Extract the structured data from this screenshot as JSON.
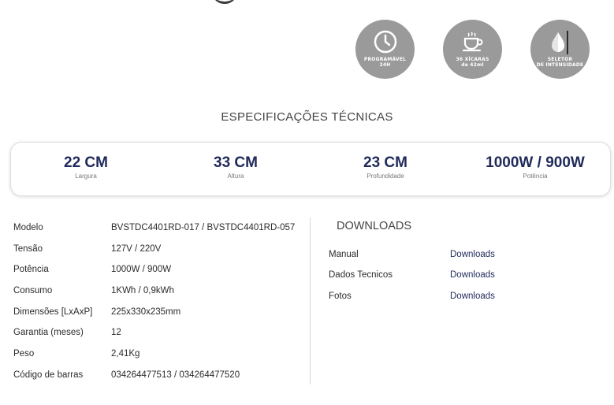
{
  "features": [
    {
      "icon": "clock-icon",
      "line1": "PROGRAMÁVEL",
      "line2": "24H"
    },
    {
      "icon": "coffee-cup-icon",
      "line1": "36 XÍCARAS",
      "line2": "de 42ml"
    },
    {
      "icon": "intensity-drop-icon",
      "line1": "SELETOR",
      "line2": "DE INTENSIDADE"
    }
  ],
  "specs_title": "ESPECIFICAÇÕES TÉCNICAS",
  "dimensions": [
    {
      "value": "22 CM",
      "label": "Largura"
    },
    {
      "value": "33 CM",
      "label": "Altura"
    },
    {
      "value": "23 CM",
      "label": "Profundidade"
    },
    {
      "value": "1000W / 900W",
      "label": "Potência"
    }
  ],
  "spec_rows": [
    {
      "key": "Modelo",
      "value": "BVSTDC4401RD-017 / BVSTDC4401RD-057"
    },
    {
      "key": "Tensão",
      "value": "127V / 220V"
    },
    {
      "key": "Potência",
      "value": "1000W / 900W"
    },
    {
      "key": "Consumo",
      "value": "1KWh / 0,9kWh"
    },
    {
      "key": "Dimensões [LxAxP]",
      "value": "225x330x235mm"
    },
    {
      "key": "Garantia (meses)",
      "value": "12"
    },
    {
      "key": "Peso",
      "value": "2,41Kg"
    },
    {
      "key": "Código de barras",
      "value": "034264477513 / 034264477520"
    }
  ],
  "downloads": {
    "title": "DOWNLOADS",
    "rows": [
      {
        "key": "Manual",
        "link": "Downloads"
      },
      {
        "key": "Dados Tecnicos",
        "link": "Downloads"
      },
      {
        "key": "Fotos",
        "link": "Downloads"
      }
    ]
  },
  "colors": {
    "accent_navy": "#1f2a5a",
    "badge_gray": "#9a9a9a"
  }
}
